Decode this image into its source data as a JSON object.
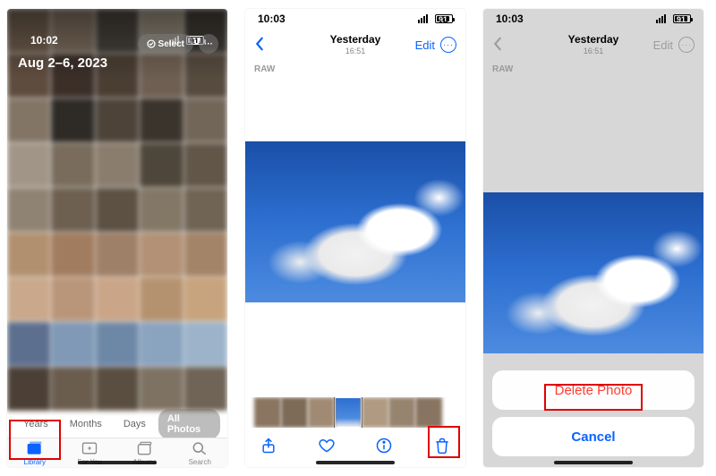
{
  "screen1": {
    "time": "10:02",
    "battery": "91",
    "date_range": "Aug 2–6, 2023",
    "select_label": "Select",
    "segments": {
      "years": "Years",
      "months": "Months",
      "days": "Days",
      "all": "All Photos"
    },
    "tabs": {
      "library": "Library",
      "foryou": "For You",
      "albums": "Albums",
      "search": "Search"
    }
  },
  "screen2": {
    "time": "10:03",
    "battery": "91",
    "nav_title": "Yesterday",
    "nav_subtitle": "16:51",
    "edit_label": "Edit",
    "raw_badge": "RAW"
  },
  "screen3": {
    "time": "10:03",
    "battery": "91",
    "nav_title": "Yesterday",
    "nav_subtitle": "16:51",
    "edit_label": "Edit",
    "raw_badge": "RAW",
    "delete_label": "Delete Photo",
    "cancel_label": "Cancel"
  },
  "grid_colors": [
    "#6b5a4a",
    "#7a6a5c",
    "#45403a",
    "#8d8474",
    "#3f3a34",
    "#5e4c3e",
    "#3b2f28",
    "#4a3e33",
    "#6e5f52",
    "#574b3f",
    "#837566",
    "#2e2a25",
    "#4d4339",
    "#3a342c",
    "#726658",
    "#a19587",
    "#796c5c",
    "#8a7d6e",
    "#4e463a",
    "#625649",
    "#8f8373",
    "#6d6051",
    "#5c5143",
    "#837766",
    "#706455",
    "#b1906f",
    "#a17c5f",
    "#9e7f67",
    "#b29176",
    "#a38468",
    "#c9a88c",
    "#b99679",
    "#caa587",
    "#b5926f",
    "#c7a37e",
    "#5d6f8e",
    "#7f99b6",
    "#6d88a7",
    "#8aa3be",
    "#9cb3c9",
    "#4c4036",
    "#6a5d4e",
    "#5a4e41",
    "#7e7263",
    "#6f6456"
  ],
  "filmstrip_colors": [
    "#8a7560",
    "#7d6a57",
    "#a08a73",
    "#6f5e4d",
    "#b09a82",
    "#97846e",
    "#887460"
  ]
}
